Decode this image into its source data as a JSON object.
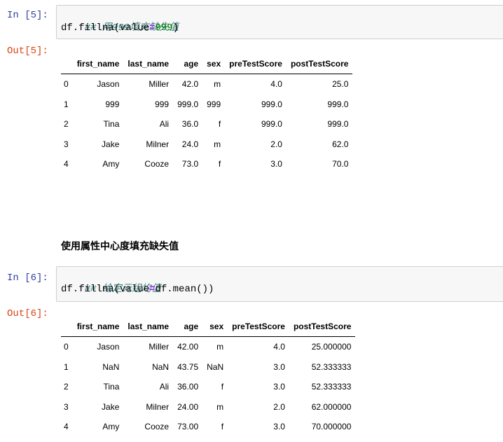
{
  "cell1": {
    "in_prompt": "In [5]:",
    "out_prompt": "Out[5]:",
    "code": {
      "comment": "## 用999填充缺失值",
      "line2_a": "df.fillna(value",
      "line2_eq": "=",
      "line2_num": "999",
      "line2_end": ")"
    },
    "table": {
      "columns": [
        "first_name",
        "last_name",
        "age",
        "sex",
        "preTestScore",
        "postTestScore"
      ],
      "rows": [
        [
          "0",
          "Jason",
          "Miller",
          "42.0",
          "m",
          "4.0",
          "25.0"
        ],
        [
          "1",
          "999",
          "999",
          "999.0",
          "999",
          "999.0",
          "999.0"
        ],
        [
          "2",
          "Tina",
          "Ali",
          "36.0",
          "f",
          "999.0",
          "999.0"
        ],
        [
          "3",
          "Jake",
          "Milner",
          "24.0",
          "m",
          "2.0",
          "62.0"
        ],
        [
          "4",
          "Amy",
          "Cooze",
          "73.0",
          "f",
          "3.0",
          "70.0"
        ]
      ]
    }
  },
  "markdown_heading": "使用属性中心度填充缺失值",
  "cell2": {
    "in_prompt": "In [6]:",
    "out_prompt": "Out[6]:",
    "code": {
      "comment": "## 给定元组均值",
      "line2_a": "df.fillna(value",
      "line2_eq": "=",
      "line2_b": "df.mean())"
    },
    "table": {
      "columns": [
        "first_name",
        "last_name",
        "age",
        "sex",
        "preTestScore",
        "postTestScore"
      ],
      "rows": [
        [
          "0",
          "Jason",
          "Miller",
          "42.00",
          "m",
          "4.0",
          "25.000000"
        ],
        [
          "1",
          "NaN",
          "NaN",
          "43.75",
          "NaN",
          "3.0",
          "52.333333"
        ],
        [
          "2",
          "Tina",
          "Ali",
          "36.00",
          "f",
          "3.0",
          "52.333333"
        ],
        [
          "3",
          "Jake",
          "Milner",
          "24.00",
          "m",
          "2.0",
          "62.000000"
        ],
        [
          "4",
          "Amy",
          "Cooze",
          "73.00",
          "f",
          "3.0",
          "70.000000"
        ]
      ]
    }
  }
}
